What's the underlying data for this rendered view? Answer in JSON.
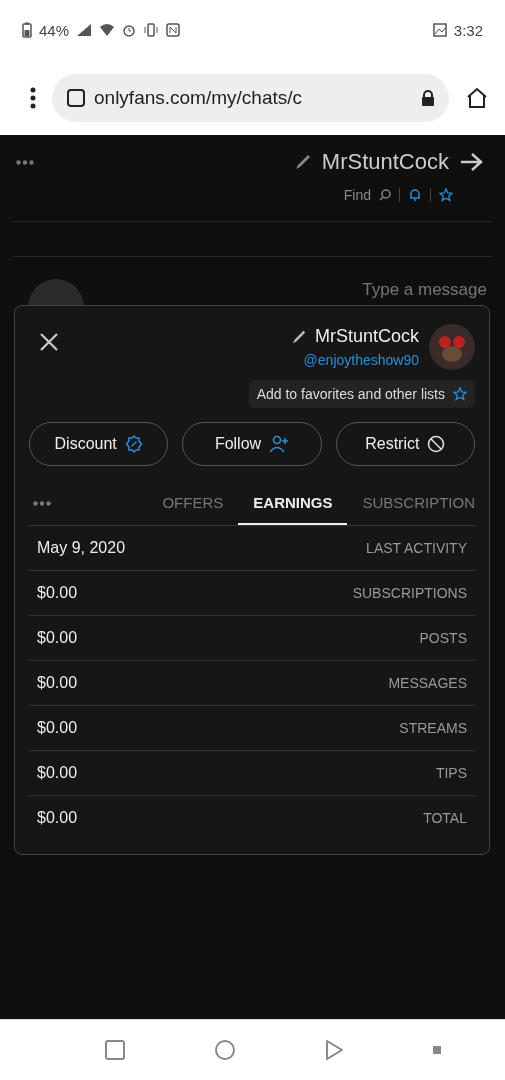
{
  "status_bar": {
    "battery": "44%",
    "time": "3:32"
  },
  "browser": {
    "url": "onlyfans.com/my/chats/c"
  },
  "chat": {
    "title": "MrStuntCock",
    "search": "Find",
    "composer": {
      "placeholder": "Type a message"
    }
  },
  "profile": {
    "name": "MrStuntCock",
    "handle": "@enjoytheshow90",
    "favorites": "Add to favorites and other lists",
    "buttons": [
      {
        "kind": "discount",
        "label": "Discount"
      },
      {
        "kind": "follow",
        "label": "Follow"
      },
      {
        "kind": "restrict",
        "label": "Restrict"
      }
    ],
    "tabs": [
      {
        "label": "OFFERS",
        "selected": false
      },
      {
        "label": "EARNINGS",
        "selected": true
      },
      {
        "label": "SUBSCRIPTION",
        "selected": false
      }
    ],
    "rows": [
      {
        "label": "LAST ACTIVITY",
        "value": "May 9, 2020"
      },
      {
        "label": "SUBSCRIPTIONS",
        "value": "$0.00"
      },
      {
        "label": "POSTS",
        "value": "$0.00"
      },
      {
        "label": "MESSAGES",
        "value": "$0.00"
      },
      {
        "label": "STREAMS",
        "value": "$0.00"
      },
      {
        "label": "TIPS",
        "value": "$0.00"
      },
      {
        "label": "TOTAL",
        "value": "$0.00"
      }
    ]
  }
}
